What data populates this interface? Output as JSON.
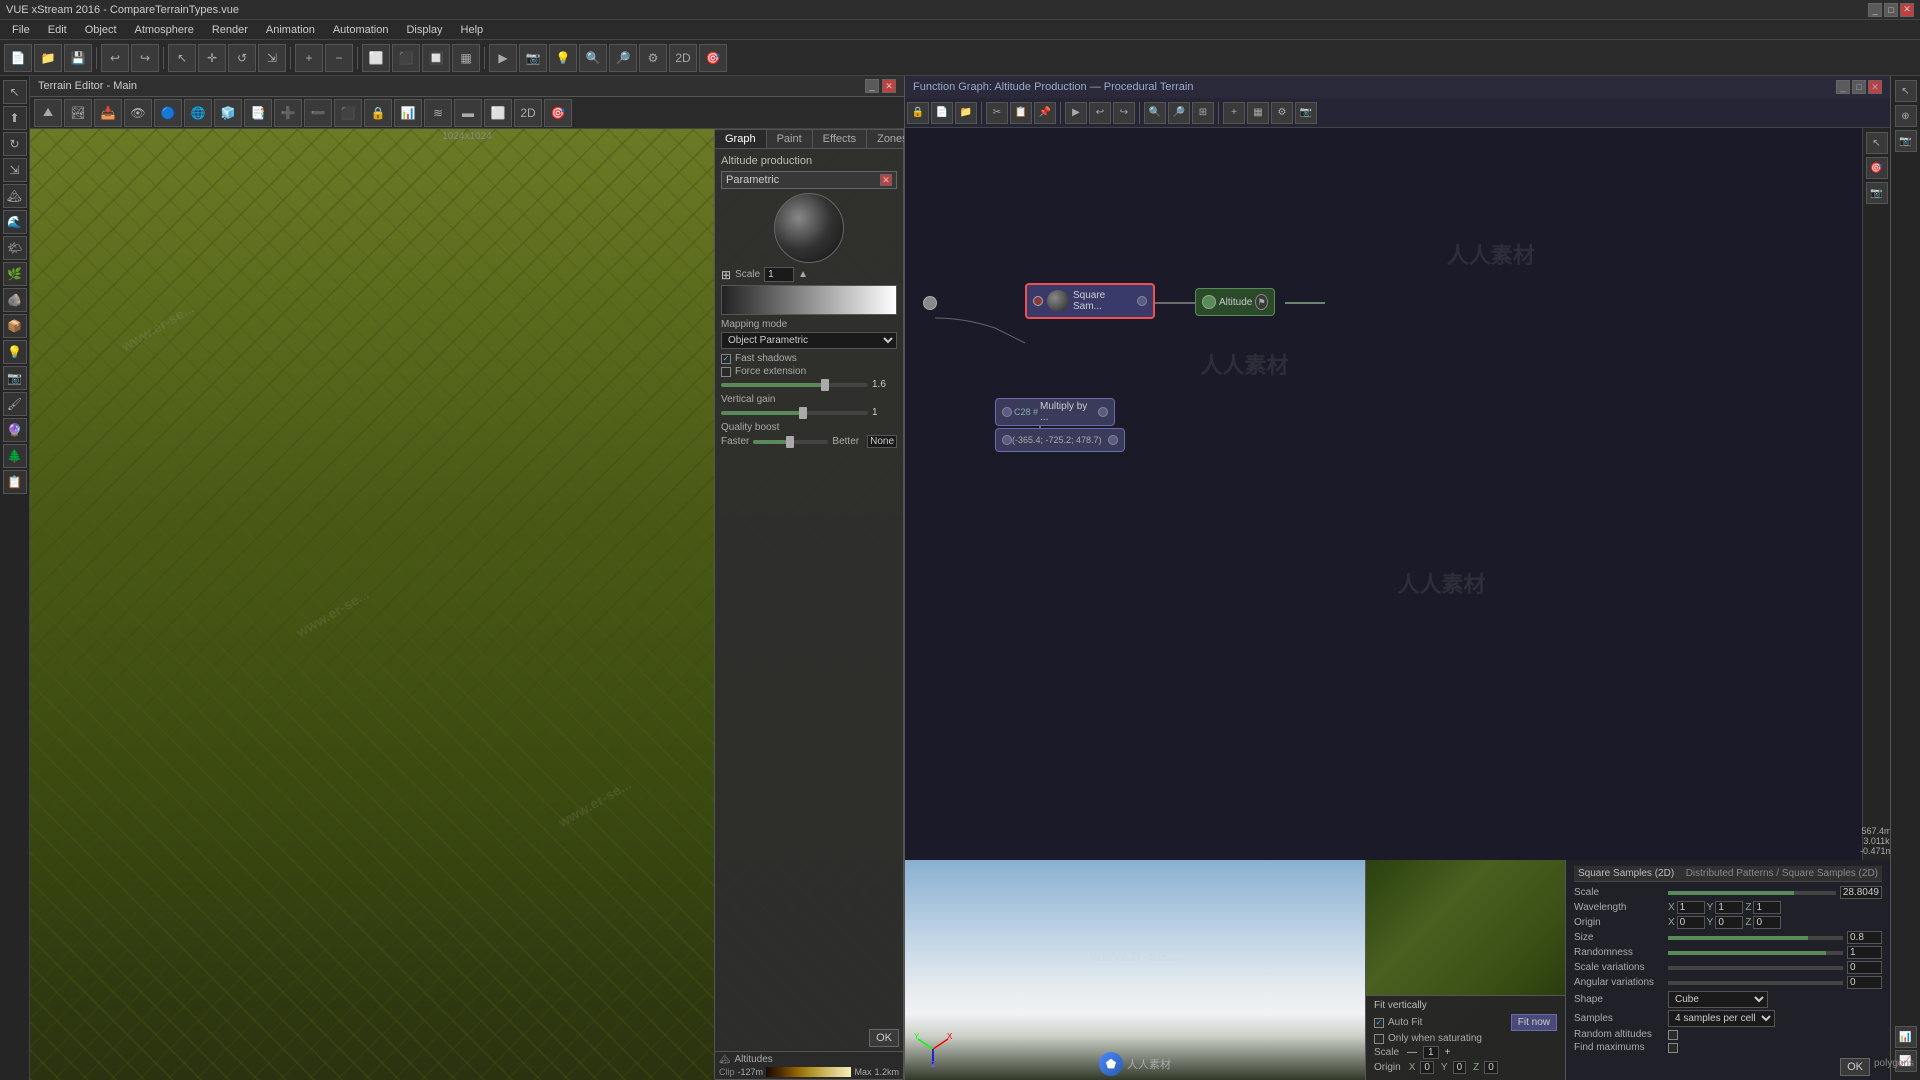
{
  "window": {
    "title_left": "VUE xStream 2016 - CompareTerrainTypes.vue",
    "title_right": "Function Graph: Altitude Production — Procedural Terrain"
  },
  "menu": {
    "items": [
      "File",
      "Edit",
      "Object",
      "Atmosphere",
      "Render",
      "Animation",
      "Automation",
      "Display",
      "Help"
    ]
  },
  "terrain_editor": {
    "title": "Terrain Editor - Main",
    "resolution": "1024x1024",
    "tabs": [
      "Graph",
      "Paint",
      "Effects",
      "Zones"
    ],
    "active_tab": "Graph",
    "section": "Altitude production",
    "node_type": "Parametric",
    "scale_label": "Scale",
    "scale_value": "1",
    "mapping_mode_label": "Mapping mode",
    "mapping_mode_value": "Object Parametric",
    "fast_shadows": true,
    "force_extension": false,
    "force_extension_value": "1.6",
    "vertical_gain_label": "Vertical gain",
    "vertical_gain_value": "1",
    "quality_boost_label": "Quality boost",
    "quality_boost_faster": "Faster",
    "quality_boost_better": "Better",
    "quality_boost_value": "None",
    "altitude_label": "Altitudes",
    "clip_label": "Clip",
    "clip_min": "-127m",
    "clip_max": "Max",
    "clip_value": "1.2km"
  },
  "function_graph": {
    "title": "Function Graph: Altitude Production — Procedural Terrain",
    "nodes": [
      {
        "id": "square_samples",
        "label": "Square Sam...",
        "type": "square_samples"
      },
      {
        "id": "altitude",
        "label": "Altitude",
        "type": "altitude"
      },
      {
        "id": "multiply",
        "label": "Multiply by ...",
        "type": "multiply",
        "prefix": "C28 #"
      },
      {
        "id": "coords",
        "label": "(-365.4; -725.2; 478.7)",
        "type": "coords"
      }
    ]
  },
  "properties_panel": {
    "header": "Square Samples (2D)",
    "breadcrumb": "Distributed Patterns / Square Samples (2D)",
    "scale_label": "Scale",
    "scale_value": "28.8049",
    "wavelength_label": "Wavelength",
    "wx": "1",
    "wy": "1",
    "wz": "1",
    "origin_label": "Origin",
    "ox": "0",
    "oy": "0",
    "oz": "0",
    "size_label": "Size",
    "size_value": "0.8",
    "randomness_label": "Randomness",
    "randomness_value": "1",
    "scale_variations_label": "Scale variations",
    "scale_variations_value": "0",
    "angular_variations_label": "Angular variations",
    "angular_variations_value": "0",
    "shape_label": "Shape",
    "shape_value": "Cube",
    "samples_label": "Samples",
    "samples_value": "4 samples per cell",
    "random_altitudes_label": "Random altitudes",
    "find_maximums_label": "Find maximums"
  },
  "fit_vertically": {
    "label": "Fit vertically",
    "auto_fit": true,
    "auto_fit_label": "Auto Fit",
    "only_saturating_label": "Only when saturating",
    "fit_now_btn": "Fit now",
    "scale_label": "Scale",
    "scale_minus": "—",
    "scale_value": "1",
    "scale_plus": "+",
    "origin_label": "Origin",
    "ox": "0",
    "oy": "0",
    "oz": "0"
  },
  "bottom_buttons": {
    "ok": "OK",
    "cancel_icon": "✕",
    "ok2": "OK",
    "polygons": "polygons"
  },
  "toolbar_icons": [
    "⬛",
    "📄",
    "💾",
    "📁",
    "🔧",
    "↩",
    "↪",
    "⬆",
    "⬇",
    "↕",
    "🔍",
    "🔎",
    "⚙",
    "📷"
  ],
  "left_sidebar_icons": [
    "↖",
    "⬆",
    "↗",
    "←",
    "·",
    "→",
    "↙",
    "⬇",
    "↘",
    "✂",
    "⬜",
    "🔶",
    "⬡",
    "○",
    "△",
    "✦",
    "🎨",
    "📐",
    "✏",
    "📌",
    "🔗",
    "🔄",
    "🎯",
    "🔀"
  ]
}
